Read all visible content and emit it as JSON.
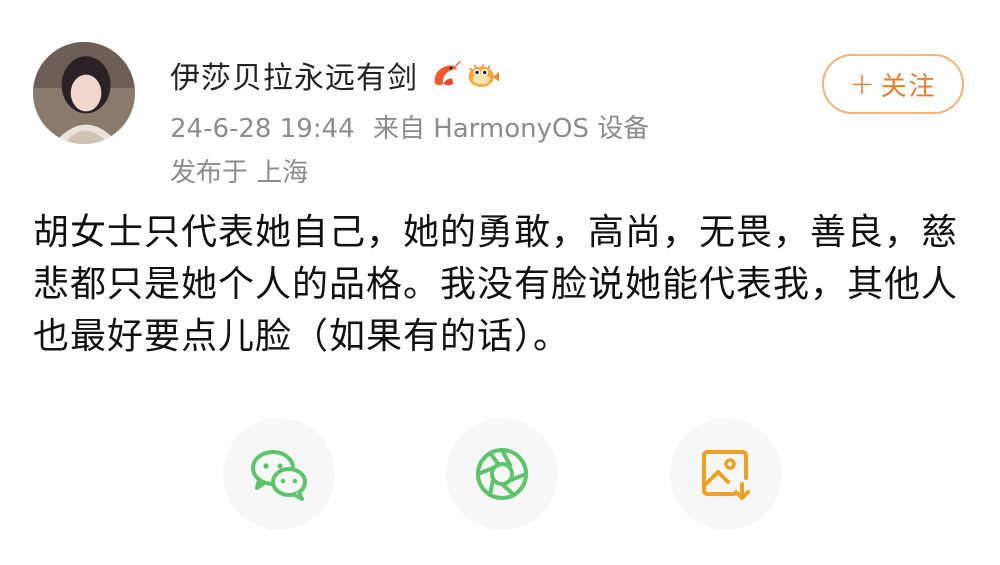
{
  "user": {
    "name": "伊莎贝拉永远有剑",
    "badges": [
      "shrimp-badge-icon",
      "pufferfish-badge-icon"
    ]
  },
  "meta": {
    "timestamp": "24-6-28 19:44",
    "source": "来自 HarmonyOS 设备",
    "location": "发布于 上海"
  },
  "follow_button": {
    "label": "关注"
  },
  "post": {
    "text": "胡女士只代表她自己，她的勇敢，高尚，无畏，善良，慈悲都只是她个人的品格。我没有脸说她能代表我，其他人也最好要点儿脸（如果有的话）。"
  },
  "share": {
    "items": [
      "wechat-icon",
      "moments-icon",
      "save-image-icon"
    ]
  },
  "colors": {
    "accent": "#ea7a2d",
    "wechat": "#5cc46b",
    "moments": "#5cc46b",
    "image": "#f0a020",
    "meta_text": "#8c8c8c"
  }
}
